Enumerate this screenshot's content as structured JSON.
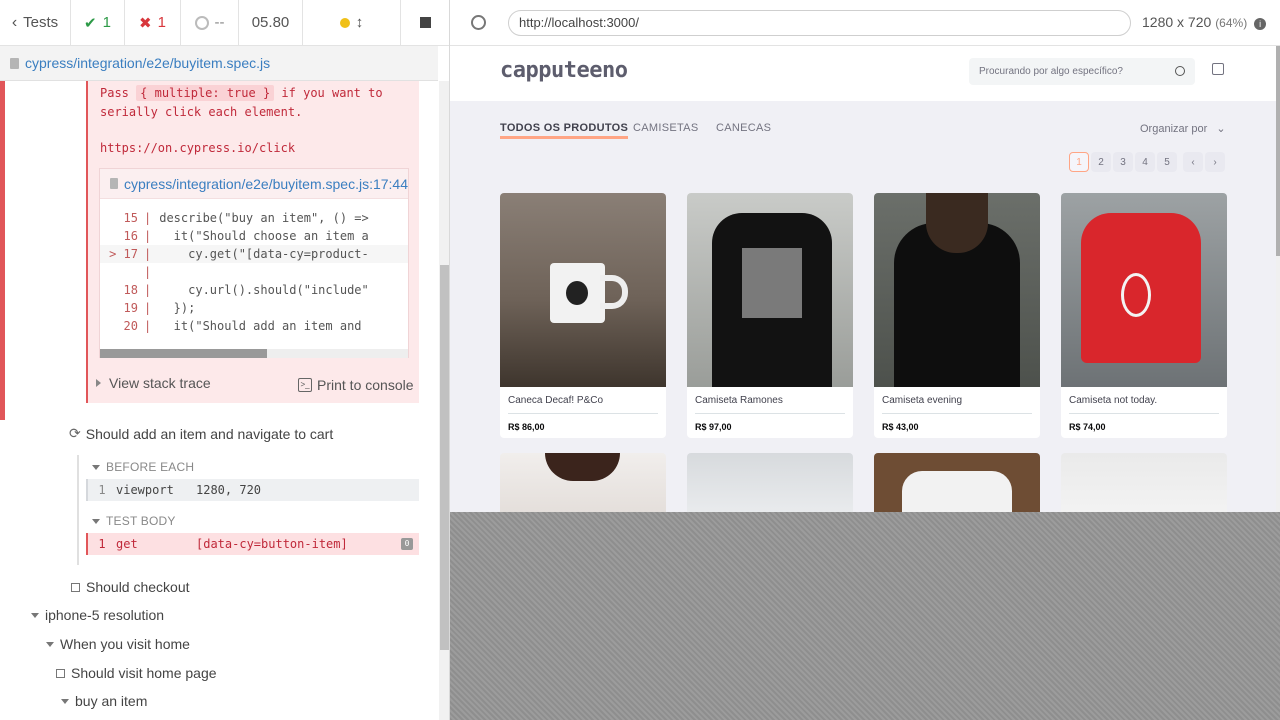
{
  "reporter": {
    "back_label": "Tests",
    "passed": "1",
    "failed": "1",
    "pending": "--",
    "duration": "05.80",
    "spec_file": "cypress/integration/e2e/buyitem.spec.js",
    "error": {
      "line1_pre": "Pass",
      "line1_chip": "{ multiple: true }",
      "line1_post": "if you want to",
      "line2": "serially click each element.",
      "link": "https://on.cypress.io/click",
      "code_file": "cypress/integration/e2e/buyitem.spec.js:17:44",
      "code_lines": [
        {
          "num": "15",
          "text": "describe(\"buy an item\", () =>"
        },
        {
          "num": "16",
          "text": "  it(\"Should choose an item a"
        },
        {
          "num": "> 17",
          "text": "    cy.get(\"[data-cy=product-"
        },
        {
          "num": "",
          "text": ""
        },
        {
          "num": "18",
          "text": "    cy.url().should(\"include\""
        },
        {
          "num": "19",
          "text": "  });"
        },
        {
          "num": "20",
          "text": "  it(\"Should add an item and"
        }
      ],
      "stack_trace_label": "View stack trace",
      "print_label": "Print to console"
    },
    "test_add_cart": "Should add an item and navigate to cart",
    "before_each_label": "BEFORE EACH",
    "viewport_cmd": {
      "num": "1",
      "name": "viewport",
      "arg": "1280, 720"
    },
    "test_body_label": "TEST BODY",
    "get_cmd": {
      "num": "1",
      "name": "get",
      "arg": "[data-cy=button-item]",
      "badge": "0"
    },
    "test_checkout": "Should checkout",
    "suite_iphone": "iphone-5 resolution",
    "suite_visit": "When you visit home",
    "test_visit_home": "Should visit home page",
    "suite_buy": "buy an item"
  },
  "browser": {
    "url": "http://localhost:3000/",
    "viewport": "1280 x 720",
    "scale": "(64%)"
  },
  "shop": {
    "logo": "capputeeno",
    "search_placeholder": "Procurando por algo específico?",
    "tabs": [
      "TODOS OS PRODUTOS",
      "CAMISETAS",
      "CANECAS"
    ],
    "order_label": "Organizar por",
    "pages": [
      "1",
      "2",
      "3",
      "4",
      "5"
    ],
    "products": [
      {
        "name": "Caneca Decaf! P&Co",
        "price": "R$ 86,00"
      },
      {
        "name": "Camiseta Ramones",
        "price": "R$ 97,00"
      },
      {
        "name": "Camiseta evening",
        "price": "R$ 43,00"
      },
      {
        "name": "Camiseta not today.",
        "price": "R$ 74,00"
      }
    ],
    "colors": {
      "accent": "#ffa585",
      "fail": "#e15659",
      "pass": "#2d9a47"
    }
  }
}
